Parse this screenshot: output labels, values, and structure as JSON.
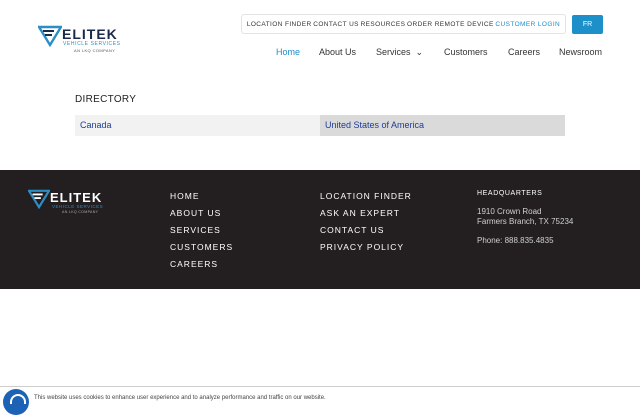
{
  "header": {
    "logo": {
      "brand": "ELITEK",
      "tagline": "VEHICLE SERVICES",
      "sub": "AN LKQ COMPANY"
    },
    "utility_nav": [
      "LOCATION FINDER",
      "CONTACT US",
      "RESOURCES",
      "ORDER REMOTE DEVICE",
      "CUSTOMER LOGIN"
    ],
    "language_button": "FR",
    "main_nav": [
      "Home",
      "About Us",
      "Services",
      "Customers",
      "Careers",
      "Newsroom"
    ]
  },
  "directory": {
    "title": "DIRECTORY",
    "countries": [
      "Canada",
      "United States of America"
    ]
  },
  "footer": {
    "logo": {
      "brand": "ELITEK",
      "tagline": "VEHICLE SERVICES",
      "sub": "AN LKQ COMPANY"
    },
    "col1": [
      "HOME",
      "ABOUT US",
      "SERVICES",
      "CUSTOMERS",
      "CAREERS"
    ],
    "col2": [
      "LOCATION FINDER",
      "ASK AN EXPERT",
      "CONTACT US",
      "PRIVACY POLICY"
    ],
    "hq": {
      "title": "HEADQUARTERS",
      "address1": "1910 Crown Road",
      "address2": "Farmers Branch, TX 75234",
      "phone": "Phone: 888.835.4835"
    }
  },
  "cookie_bar": {
    "text": "This website uses cookies to enhance user experience and to analyze performance and traffic on our website."
  },
  "colors": {
    "accent": "#1d8fc9",
    "footer_bg": "#231f20",
    "link": "#1c3c9a",
    "logo_dark": "#1b2a4a"
  }
}
